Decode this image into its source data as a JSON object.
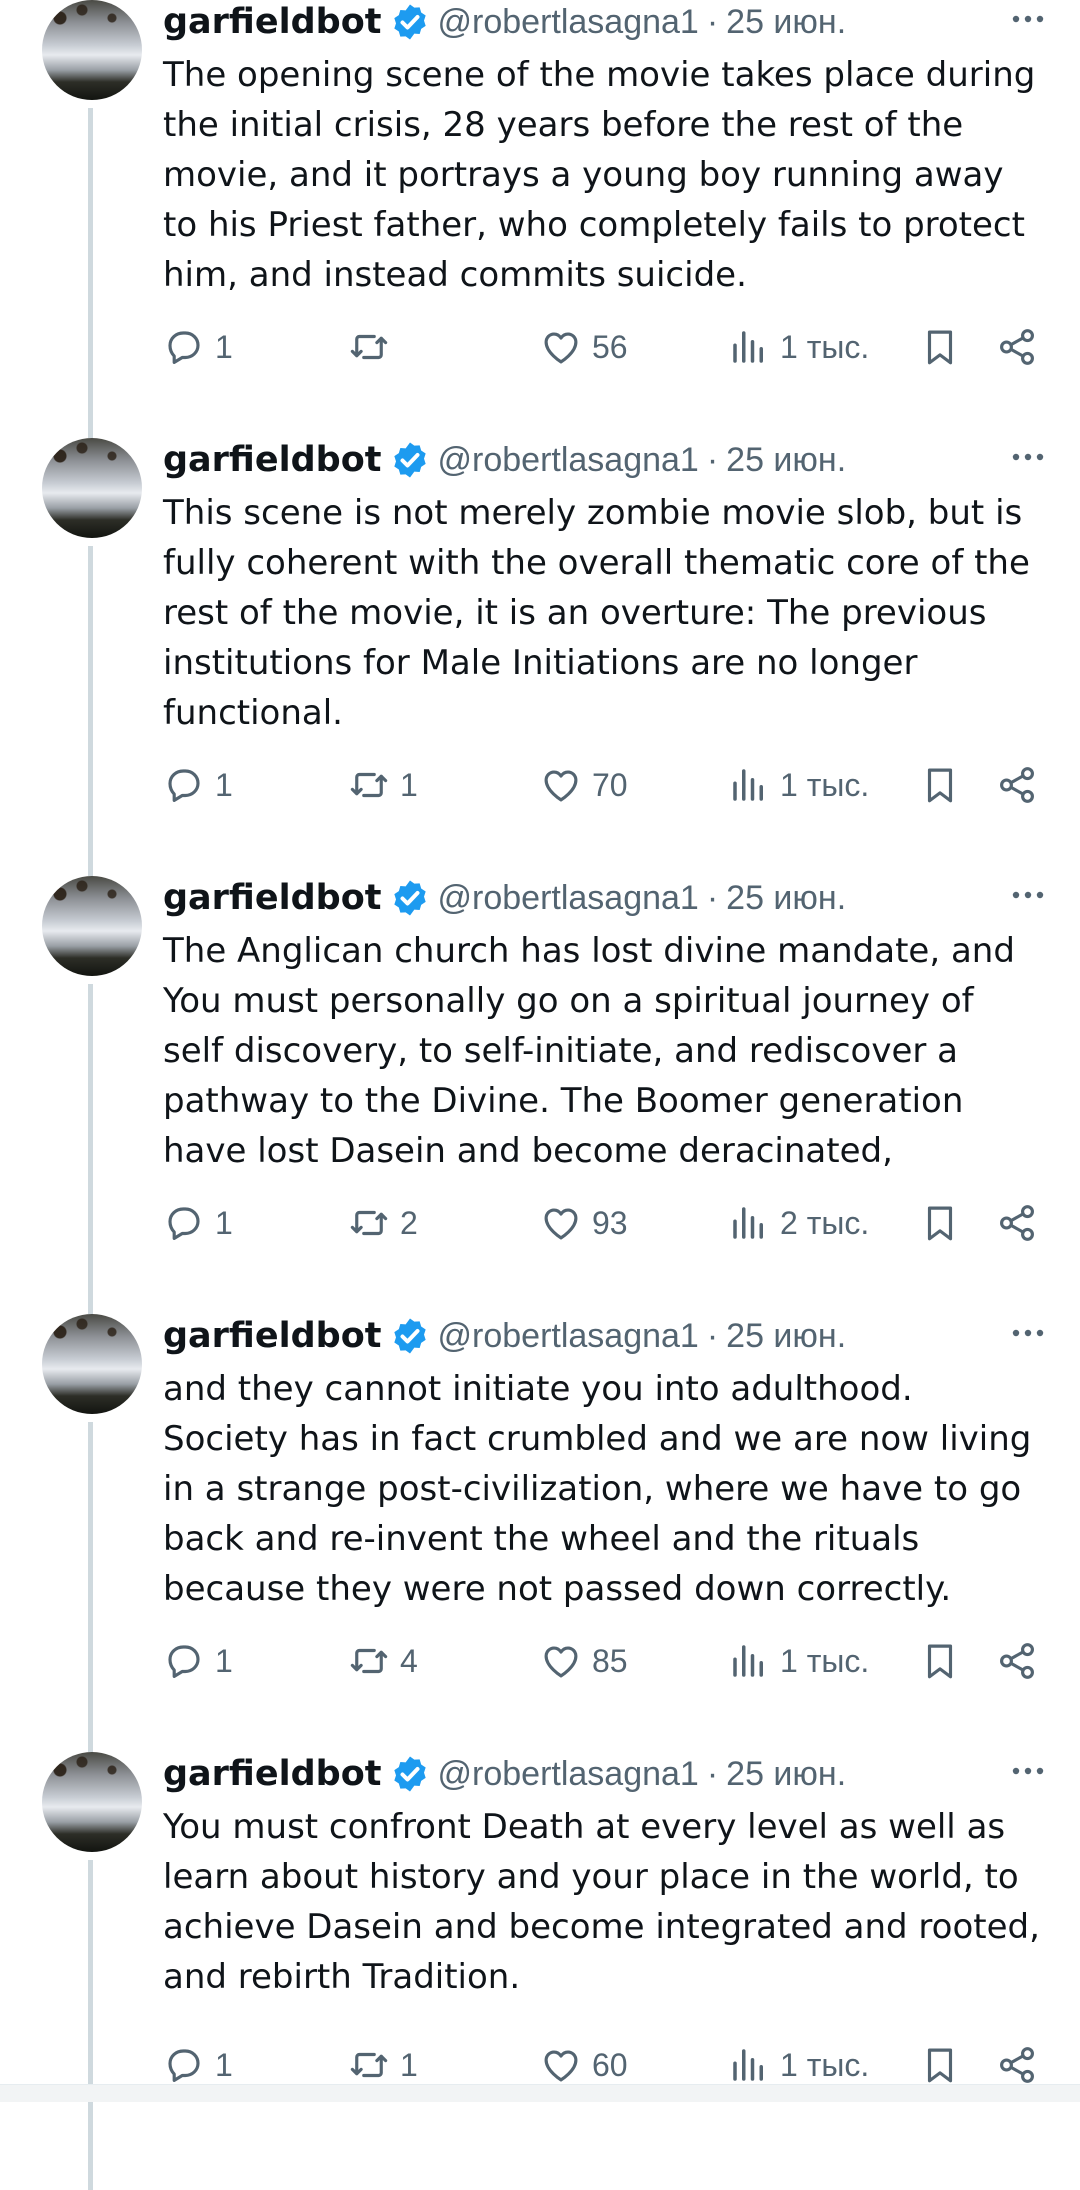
{
  "tweets": [
    {
      "name": "garfieldbot",
      "handle": "@robertlasagna1",
      "sep": "·",
      "date": "25 июн.",
      "text": "The opening scene of the movie takes place during the initial crisis, 28 years before the rest of the movie, and it portrays a young boy running away to his Priest father, who completely fails to protect him, and instead commits suicide.",
      "replies": "1",
      "retweets": "",
      "likes": "56",
      "views": "1 тыс."
    },
    {
      "name": "garfieldbot",
      "handle": "@robertlasagna1",
      "sep": "·",
      "date": "25 июн.",
      "text": "This scene is not merely zombie movie slob, but is fully coherent with the overall thematic core of the rest of the movie, it is an overture: The previous institutions for Male Initiations are no longer functional.",
      "replies": "1",
      "retweets": "1",
      "likes": "70",
      "views": "1 тыс."
    },
    {
      "name": "garfieldbot",
      "handle": "@robertlasagna1",
      "sep": "·",
      "date": "25 июн.",
      "text": "The Anglican church has lost divine mandate, and You must personally go on a spiritual journey of self discovery, to self-initiate, and rediscover a pathway to the Divine. The Boomer generation have lost Dasein and become deracinated,",
      "replies": "1",
      "retweets": "2",
      "likes": "93",
      "views": "2 тыс."
    },
    {
      "name": "garfieldbot",
      "handle": "@robertlasagna1",
      "sep": "·",
      "date": "25 июн.",
      "text": "and they cannot initiate you into adulthood. Society has in fact crumbled and we are now living in a strange post-civilization, where we have to go back and re-invent the wheel and the rituals because they were not passed down correctly.",
      "replies": "1",
      "retweets": "4",
      "likes": "85",
      "views": "1 тыс."
    },
    {
      "name": "garfieldbot",
      "handle": "@robertlasagna1",
      "sep": "·",
      "date": "25 июн.",
      "text": "You must confront Death at every level as well as learn about history and your place in the world, to achieve Dasein and become integrated and rooted, and rebirth Tradition.",
      "replies": "1",
      "retweets": "1",
      "likes": "60",
      "views": "1 тыс."
    }
  ],
  "icons": {
    "verified": "verified-badge-icon",
    "more": "more-dots-icon",
    "reply": "reply-icon",
    "retweet": "retweet-icon",
    "like": "heart-icon",
    "views": "views-icon",
    "bookmark": "bookmark-icon",
    "share": "share-icon"
  },
  "colors": {
    "text": "#0f1419",
    "secondary": "#536471",
    "verified": "#1d9bf0",
    "thread_line": "#cfd9de"
  }
}
